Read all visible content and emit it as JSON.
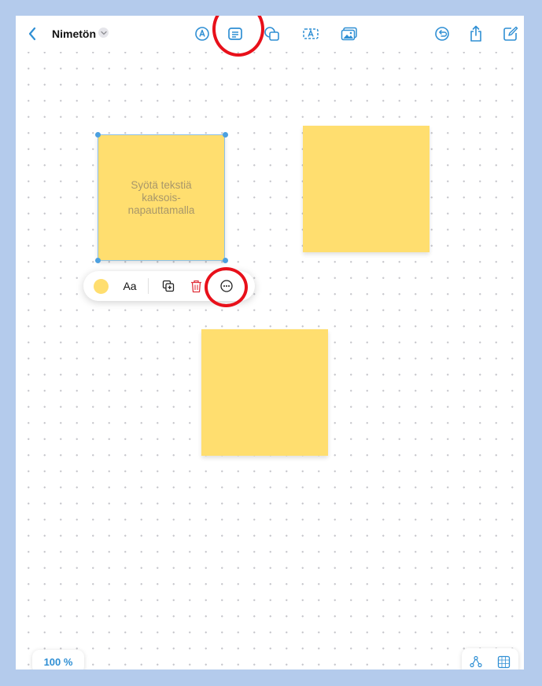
{
  "toolbar": {
    "title": "Nimetön",
    "icons": [
      "back-chevron",
      "title-chevron-down",
      "pen-markup",
      "sticky-note",
      "shapes",
      "text-box",
      "media",
      "undo",
      "share",
      "compose"
    ]
  },
  "notes": [
    {
      "text": "Syötä tekstiä\nkaksois-\nnapauttamalla",
      "selected": true
    },
    {
      "text": "",
      "selected": false
    },
    {
      "text": "",
      "selected": false
    }
  ],
  "context_menu": {
    "font_label": "Aa",
    "color": "#ffde6f",
    "icons": [
      "color-swatch",
      "font-style",
      "duplicate",
      "delete",
      "more-options"
    ]
  },
  "annotations": {
    "highlight_color": "#e8101a",
    "circled": [
      "sticky-note-tool",
      "more-options"
    ]
  },
  "zoom": {
    "label": "100 %"
  },
  "bottom_right": {
    "icons": [
      "connector",
      "grid-view"
    ]
  },
  "colors": {
    "accent": "#2f8fd4",
    "note": "#ffde6f",
    "delete": "#e0323b",
    "background_frame": "#b4cbec"
  }
}
